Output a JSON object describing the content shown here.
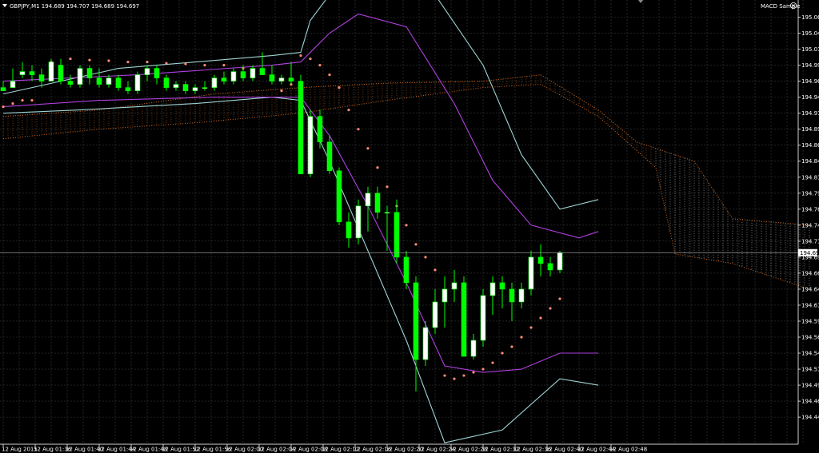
{
  "header": {
    "symbol_info": "GBPJPY,M1  194.689 194.707 194.689 194.697",
    "indicator_name": "MACD Sample"
  },
  "colors": {
    "background": "#000000",
    "grid": "#3a3a3a",
    "bull_candle": "#ffffff",
    "bear_candle": "#00ff00",
    "wick": "#00ff00",
    "envelope": "#9fd3d3",
    "bollinger": "#b040e0",
    "sar": "#ff8c73",
    "cloud": "#d2691e",
    "price_label_bg": "#ffffff",
    "price_label_fg": "#000000"
  },
  "chart_data": {
    "type": "candlestick",
    "symbol": "GBPJPY",
    "timeframe": "M1",
    "ylim": [
      194.425,
      195.075
    ],
    "y_ticks": [
      "195.065",
      "195.040",
      "195.015",
      "194.990",
      "194.965",
      "194.940",
      "194.915",
      "194.890",
      "194.865",
      "194.840",
      "194.815",
      "194.790",
      "194.765",
      "194.740",
      "194.715",
      "194.690",
      "194.665",
      "194.640",
      "194.615",
      "194.590",
      "194.565",
      "194.540",
      "194.515",
      "194.490",
      "194.465",
      "194.440"
    ],
    "x_ticks": [
      "12 Aug 2015",
      "12 Aug 01:36",
      "12 Aug 01:40",
      "12 Aug 01:44",
      "12 Aug 01:48",
      "12 Aug 01:52",
      "12 Aug 01:56",
      "12 Aug 02:00",
      "12 Aug 02:04",
      "12 Aug 02:08",
      "12 Aug 02:12",
      "12 Aug 02:16",
      "12 Aug 02:20",
      "12 Aug 02:24",
      "12 Aug 02:28",
      "12 Aug 02:32",
      "12 Aug 02:36",
      "12 Aug 02:40",
      "12 Aug 02:44",
      "12 Aug 02:48"
    ],
    "current_price": "194.697",
    "grid": true,
    "candles": [
      [
        194.955,
        194.965,
        194.955,
        194.95
      ],
      [
        194.955,
        194.985,
        194.955,
        194.965
      ],
      [
        194.975,
        194.995,
        194.97,
        194.98
      ],
      [
        194.98,
        194.99,
        194.965,
        194.975
      ],
      [
        194.975,
        194.985,
        194.955,
        194.965
      ],
      [
        194.965,
        195.0,
        194.965,
        194.995
      ],
      [
        194.99,
        195.0,
        194.96,
        194.965
      ],
      [
        194.965,
        194.975,
        194.955,
        194.96
      ],
      [
        194.96,
        194.99,
        194.955,
        194.985
      ],
      [
        194.985,
        194.99,
        194.96,
        194.97
      ],
      [
        194.97,
        194.985,
        194.955,
        194.96
      ],
      [
        194.96,
        194.975,
        194.955,
        194.97
      ],
      [
        194.97,
        194.975,
        194.95,
        194.955
      ],
      [
        194.955,
        194.965,
        194.945,
        194.95
      ],
      [
        194.95,
        194.98,
        194.945,
        194.975
      ],
      [
        194.975,
        194.99,
        194.965,
        194.985
      ],
      [
        194.985,
        194.99,
        194.96,
        194.97
      ],
      [
        194.97,
        194.975,
        194.95,
        194.955
      ],
      [
        194.955,
        194.965,
        194.95,
        194.96
      ],
      [
        194.96,
        194.965,
        194.945,
        194.95
      ],
      [
        194.95,
        194.96,
        194.945,
        194.955
      ],
      [
        194.955,
        194.965,
        194.95,
        194.955
      ],
      [
        194.955,
        194.975,
        194.95,
        194.97
      ],
      [
        194.97,
        194.98,
        194.96,
        194.965
      ],
      [
        194.965,
        194.985,
        194.96,
        194.98
      ],
      [
        194.98,
        194.99,
        194.965,
        194.97
      ],
      [
        194.97,
        194.99,
        194.965,
        194.985
      ],
      [
        194.985,
        195.01,
        194.98,
        194.975
      ],
      [
        194.975,
        194.99,
        194.96,
        194.965
      ],
      [
        194.965,
        194.975,
        194.96,
        194.97
      ],
      [
        194.97,
        194.995,
        194.96,
        194.965
      ],
      [
        194.965,
        194.975,
        194.82,
        194.82
      ],
      [
        194.82,
        194.92,
        194.815,
        194.91
      ],
      [
        194.91,
        194.92,
        194.86,
        194.87
      ],
      [
        194.87,
        194.88,
        194.82,
        194.825
      ],
      [
        194.825,
        194.83,
        194.74,
        194.745
      ],
      [
        194.745,
        194.76,
        194.705,
        194.72
      ],
      [
        194.72,
        194.78,
        194.71,
        194.77
      ],
      [
        194.77,
        194.8,
        194.73,
        194.79
      ],
      [
        194.79,
        194.8,
        194.75,
        194.76
      ],
      [
        194.76,
        194.77,
        194.7,
        194.76
      ],
      [
        194.76,
        194.78,
        194.68,
        194.69
      ],
      [
        194.69,
        194.7,
        194.64,
        194.65
      ],
      [
        194.65,
        194.66,
        194.48,
        194.53
      ],
      [
        194.53,
        194.59,
        194.52,
        194.58
      ],
      [
        194.58,
        194.64,
        194.57,
        194.62
      ],
      [
        194.62,
        194.66,
        194.58,
        194.64
      ],
      [
        194.64,
        194.67,
        194.62,
        194.65
      ],
      [
        194.65,
        194.66,
        194.56,
        194.535
      ],
      [
        194.535,
        194.57,
        194.53,
        194.56
      ],
      [
        194.56,
        194.64,
        194.55,
        194.63
      ],
      [
        194.63,
        194.66,
        194.6,
        194.65
      ],
      [
        194.65,
        194.66,
        194.61,
        194.64
      ],
      [
        194.64,
        194.65,
        194.59,
        194.62
      ],
      [
        194.62,
        194.65,
        194.61,
        194.64
      ],
      [
        194.64,
        194.7,
        194.63,
        194.69
      ],
      [
        194.69,
        194.71,
        194.66,
        194.68
      ],
      [
        194.68,
        194.69,
        194.66,
        194.67
      ],
      [
        194.67,
        194.7,
        194.665,
        194.697
      ]
    ],
    "envelope_upper": [
      [
        0,
        194.945
      ],
      [
        12,
        194.985
      ],
      [
        28,
        195.005
      ],
      [
        31,
        195.01
      ],
      [
        32,
        195.06
      ],
      [
        34,
        195.1
      ],
      [
        40,
        195.13
      ],
      [
        45,
        195.1
      ],
      [
        50,
        194.99
      ],
      [
        54,
        194.85
      ],
      [
        58,
        194.765
      ],
      [
        62,
        194.78
      ]
    ],
    "envelope_lower": [
      [
        0,
        194.915
      ],
      [
        8,
        194.92
      ],
      [
        20,
        194.93
      ],
      [
        28,
        194.94
      ],
      [
        31,
        194.935
      ],
      [
        34,
        194.84
      ],
      [
        38,
        194.7
      ],
      [
        42,
        194.56
      ],
      [
        46,
        194.4
      ],
      [
        52,
        194.42
      ],
      [
        58,
        194.5
      ],
      [
        62,
        194.49
      ]
    ],
    "bollinger_upper": [
      [
        0,
        194.965
      ],
      [
        14,
        194.975
      ],
      [
        28,
        194.99
      ],
      [
        31,
        194.995
      ],
      [
        34,
        195.04
      ],
      [
        37,
        195.07
      ],
      [
        42,
        195.05
      ],
      [
        47,
        194.93
      ],
      [
        51,
        194.81
      ],
      [
        55,
        194.74
      ],
      [
        60,
        194.72
      ],
      [
        62,
        194.73
      ]
    ],
    "bollinger_lower": [
      [
        0,
        194.925
      ],
      [
        10,
        194.935
      ],
      [
        22,
        194.94
      ],
      [
        31,
        194.94
      ],
      [
        34,
        194.88
      ],
      [
        38,
        194.77
      ],
      [
        42,
        194.65
      ],
      [
        46,
        194.52
      ],
      [
        50,
        194.51
      ],
      [
        54,
        194.515
      ],
      [
        58,
        194.54
      ],
      [
        62,
        194.54
      ]
    ],
    "sar_points": [
      [
        0,
        194.925
      ],
      [
        1,
        194.93
      ],
      [
        2,
        194.935
      ],
      [
        3,
        194.935
      ],
      [
        5,
        194.995
      ],
      [
        7,
        195.0
      ],
      [
        9,
        194.998
      ],
      [
        11,
        194.997
      ],
      [
        13,
        194.995
      ],
      [
        15,
        194.995
      ],
      [
        17,
        194.993
      ],
      [
        19,
        194.992
      ],
      [
        21,
        194.99
      ],
      [
        23,
        194.99
      ],
      [
        25,
        194.985
      ],
      [
        27,
        194.98
      ],
      [
        29,
        194.95
      ],
      [
        30,
        194.96
      ],
      [
        31,
        195.005
      ],
      [
        32,
        195.0
      ],
      [
        33,
        194.99
      ],
      [
        34,
        194.975
      ],
      [
        35,
        194.955
      ],
      [
        36,
        194.92
      ],
      [
        37,
        194.89
      ],
      [
        38,
        194.86
      ],
      [
        39,
        194.83
      ],
      [
        40,
        194.8
      ],
      [
        41,
        194.77
      ],
      [
        42,
        194.74
      ],
      [
        43,
        194.71
      ],
      [
        44,
        194.69
      ],
      [
        45,
        194.67
      ],
      [
        46,
        194.505
      ],
      [
        47,
        194.5
      ],
      [
        48,
        194.505
      ],
      [
        49,
        194.51
      ],
      [
        50,
        194.515
      ],
      [
        51,
        194.525
      ],
      [
        52,
        194.54
      ],
      [
        53,
        194.55
      ],
      [
        54,
        194.565
      ],
      [
        55,
        194.58
      ],
      [
        56,
        194.595
      ],
      [
        57,
        194.61
      ],
      [
        58,
        194.625
      ]
    ],
    "cloud_top": [
      [
        0,
        194.91
      ],
      [
        10,
        194.92
      ],
      [
        22,
        194.945
      ],
      [
        31,
        194.955
      ],
      [
        40,
        194.962
      ],
      [
        50,
        194.965
      ],
      [
        56,
        194.975
      ],
      [
        62,
        194.92
      ],
      [
        66,
        194.87
      ],
      [
        72,
        194.84
      ],
      [
        76,
        194.75
      ],
      [
        84,
        194.74
      ]
    ],
    "cloud_bottom": [
      [
        0,
        194.875
      ],
      [
        10,
        194.89
      ],
      [
        20,
        194.9
      ],
      [
        31,
        194.915
      ],
      [
        40,
        194.935
      ],
      [
        50,
        194.955
      ],
      [
        56,
        194.96
      ],
      [
        62,
        194.91
      ],
      [
        68,
        194.83
      ],
      [
        70,
        194.695
      ],
      [
        76,
        194.68
      ],
      [
        84,
        194.64
      ]
    ]
  }
}
